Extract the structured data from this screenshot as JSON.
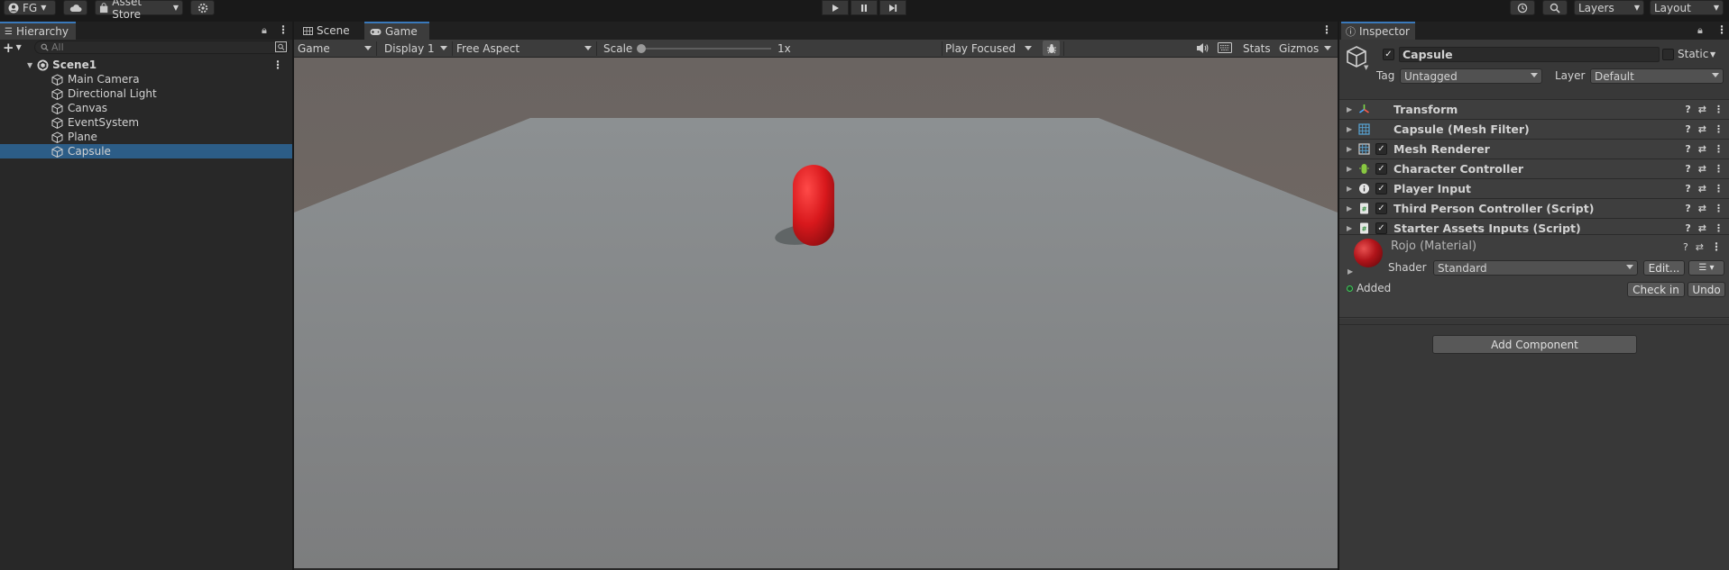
{
  "toolbar": {
    "account": "FG",
    "asset_store": "Asset Store",
    "layers": "Layers",
    "layout": "Layout"
  },
  "hierarchy": {
    "tab": "Hierarchy",
    "search_placeholder": "All",
    "scene": "Scene1",
    "items": [
      {
        "label": "Main Camera",
        "selected": false
      },
      {
        "label": "Directional Light",
        "selected": false
      },
      {
        "label": "Canvas",
        "selected": false
      },
      {
        "label": "EventSystem",
        "selected": false
      },
      {
        "label": "Plane",
        "selected": false
      },
      {
        "label": "Capsule",
        "selected": true
      }
    ]
  },
  "center": {
    "tabs": [
      {
        "label": "Scene"
      },
      {
        "label": "Game"
      }
    ],
    "active_tab": "Game",
    "game_mode": "Game",
    "display": "Display 1",
    "aspect": "Free Aspect",
    "scale_label": "Scale",
    "scale_value": "1x",
    "play_focus": "Play Focused",
    "stats": "Stats",
    "gizmos": "Gizmos"
  },
  "inspector": {
    "tab": "Inspector",
    "object_name": "Capsule",
    "static_label": "Static",
    "tag_label": "Tag",
    "tag_value": "Untagged",
    "layer_label": "Layer",
    "layer_value": "Default",
    "components": [
      {
        "label": "Transform",
        "checkbox": false,
        "icon": "transform-icon"
      },
      {
        "label": "Capsule (Mesh Filter)",
        "checkbox": false,
        "icon": "mesh-filter-icon"
      },
      {
        "label": "Mesh Renderer",
        "checkbox": true,
        "icon": "mesh-renderer-icon"
      },
      {
        "label": "Character Controller",
        "checkbox": true,
        "icon": "character-controller-icon"
      },
      {
        "label": "Player Input",
        "checkbox": true,
        "icon": "player-input-icon"
      },
      {
        "label": "Third Person Controller (Script)",
        "checkbox": true,
        "icon": "script-icon"
      },
      {
        "label": "Starter Assets Inputs (Script)",
        "checkbox": true,
        "icon": "script-icon"
      }
    ],
    "material": {
      "name": "Rojo (Material)",
      "shader_label": "Shader",
      "shader_value": "Standard",
      "edit_label": "Edit...",
      "status": "Added",
      "checkin_label": "Check in",
      "undo_label": "Undo"
    },
    "add_component": "Add Component"
  },
  "colors": {
    "accent": "#3a79bb",
    "selected_row": "#2c5d87",
    "capsule": "#d8181c",
    "added_dot": "#3fcc5a"
  }
}
